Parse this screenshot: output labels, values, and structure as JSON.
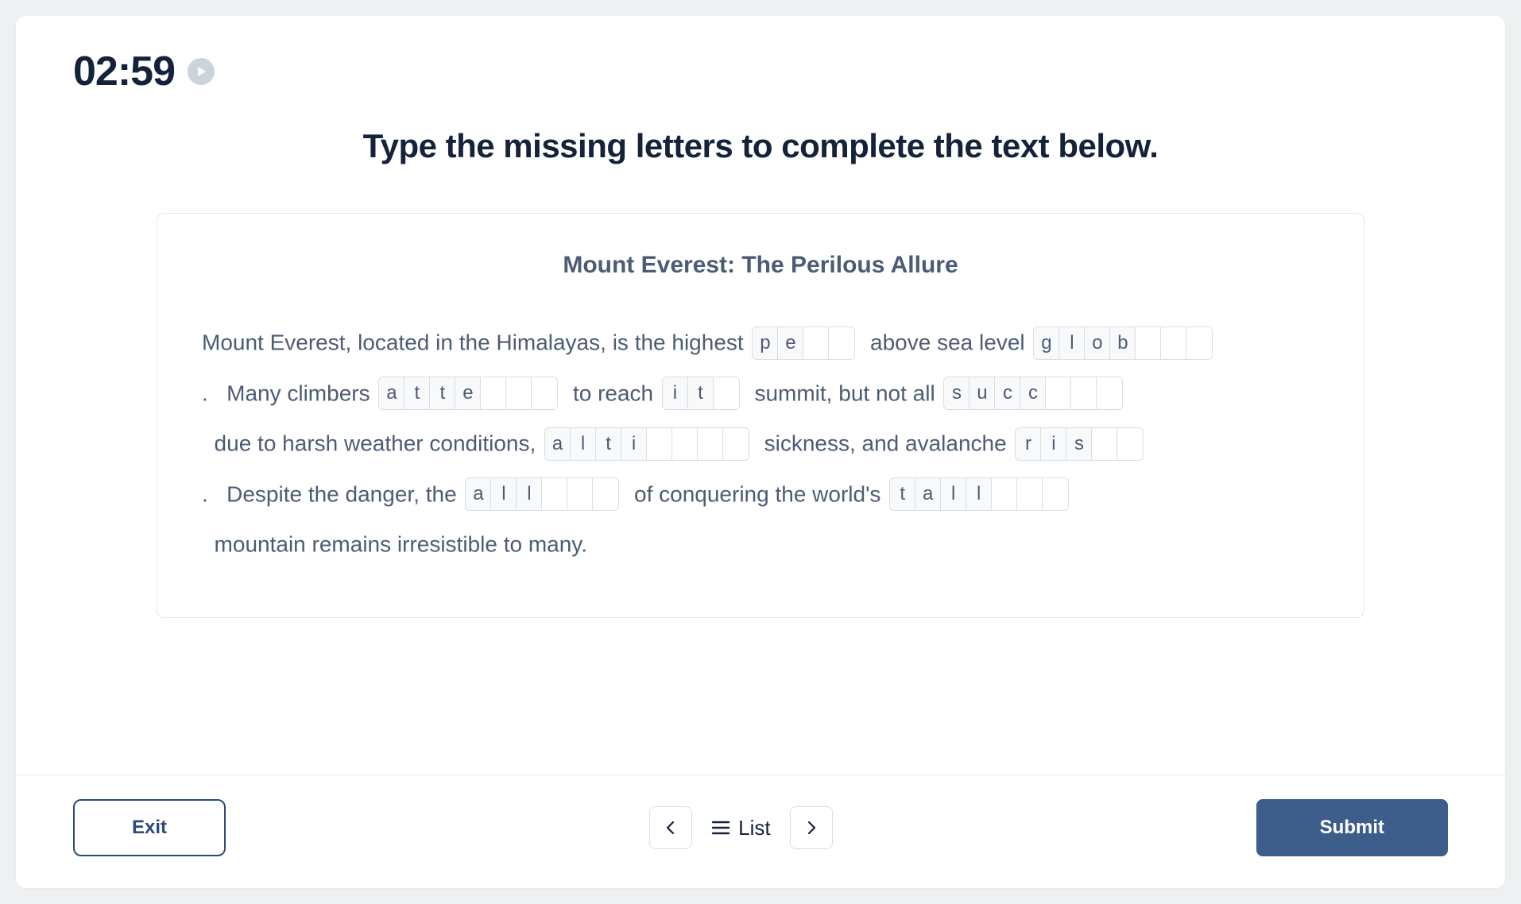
{
  "timer": {
    "value": "02:59"
  },
  "instruction": "Type the missing letters to complete the text below.",
  "passage": {
    "title": "Mount Everest: The Perilous Allure",
    "segments": [
      {
        "type": "text",
        "value": "Mount Everest, located in the Himalayas, is the highest "
      },
      {
        "type": "word",
        "id": "w1",
        "letters": [
          "p",
          "e",
          "",
          ""
        ]
      },
      {
        "type": "text",
        "value": "  above sea level "
      },
      {
        "type": "word",
        "id": "w2",
        "letters": [
          "g",
          "l",
          "o",
          "b",
          "",
          "",
          ""
        ]
      },
      {
        "type": "text",
        "value": ".   Many climbers "
      },
      {
        "type": "word",
        "id": "w3",
        "letters": [
          "a",
          "t",
          "t",
          "e",
          "",
          "",
          ""
        ]
      },
      {
        "type": "text",
        "value": "  to reach "
      },
      {
        "type": "word",
        "id": "w4",
        "letters": [
          "i",
          "t",
          ""
        ]
      },
      {
        "type": "text",
        "value": "  summit, but not all "
      },
      {
        "type": "word",
        "id": "w5",
        "letters": [
          "s",
          "u",
          "c",
          "c",
          "",
          "",
          ""
        ]
      },
      {
        "type": "text",
        "value": "  due to harsh weather conditions, "
      },
      {
        "type": "word",
        "id": "w6",
        "letters": [
          "a",
          "l",
          "t",
          "i",
          "",
          "",
          "",
          ""
        ]
      },
      {
        "type": "text",
        "value": "  sickness, and avalanche "
      },
      {
        "type": "word",
        "id": "w7",
        "letters": [
          "r",
          "i",
          "s",
          "",
          ""
        ]
      },
      {
        "type": "text",
        "value": ".   Despite the danger, the "
      },
      {
        "type": "word",
        "id": "w8",
        "letters": [
          "a",
          "l",
          "l",
          "",
          "",
          ""
        ]
      },
      {
        "type": "text",
        "value": "  of conquering the world's "
      },
      {
        "type": "word",
        "id": "w9",
        "letters": [
          "t",
          "a",
          "l",
          "l",
          "",
          "",
          ""
        ]
      },
      {
        "type": "text",
        "value": "  mountain remains irresistible to many."
      }
    ]
  },
  "footer": {
    "exit": "Exit",
    "list": "List",
    "submit": "Submit"
  }
}
